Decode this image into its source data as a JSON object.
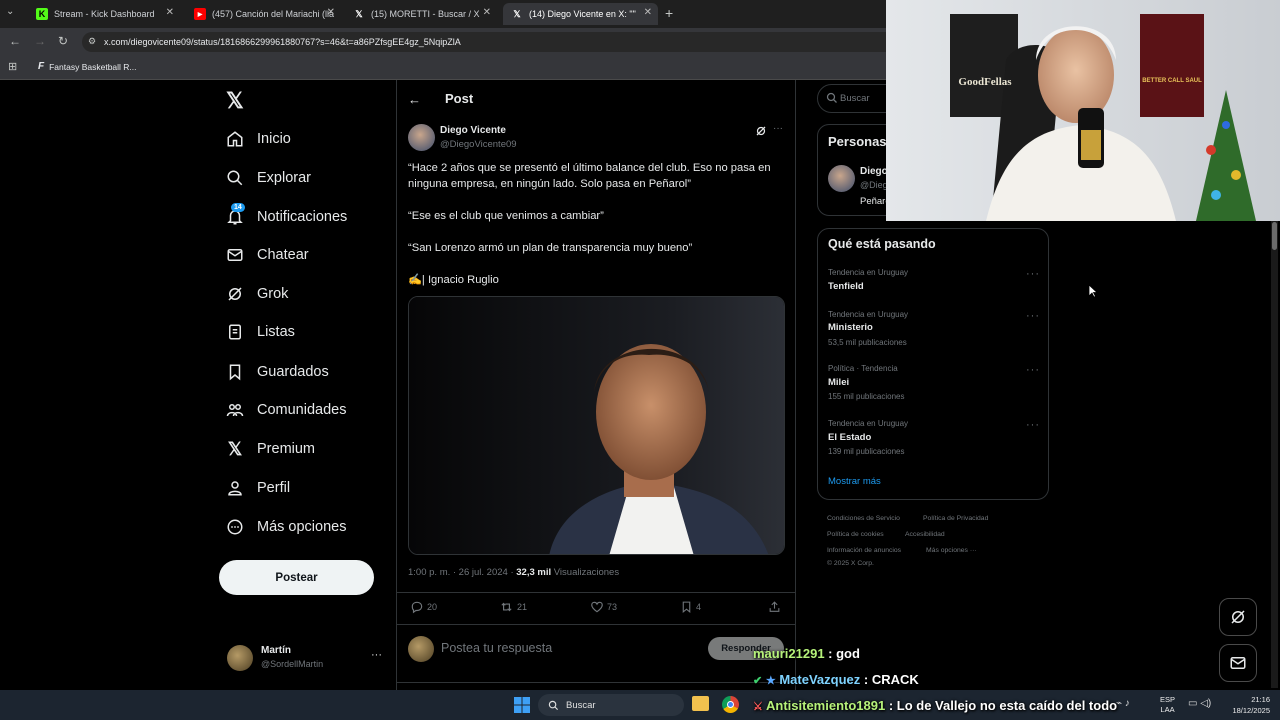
{
  "browser": {
    "tabs": [
      {
        "title": "Stream - Kick Dashboard"
      },
      {
        "title": "(457) Canción del Mariachi (lla"
      },
      {
        "title": "(15) MORETTI - Buscar / X"
      },
      {
        "title": "(14) Diego Vicente en X: \"\""
      }
    ],
    "url": "x.com/diegovicente09/status/1816866299961880767?s=46&t=a86PZfsgEE4gz_5NqipZlA",
    "bookmark": "Fantasy Basketball R..."
  },
  "nav": {
    "items": [
      {
        "label": "Inicio"
      },
      {
        "label": "Explorar"
      },
      {
        "label": "Notificaciones",
        "badge": "14"
      },
      {
        "label": "Chatear"
      },
      {
        "label": "Grok"
      },
      {
        "label": "Listas"
      },
      {
        "label": "Guardados"
      },
      {
        "label": "Comunidades"
      },
      {
        "label": "Premium"
      },
      {
        "label": "Perfil"
      },
      {
        "label": "Más opciones"
      }
    ],
    "post_button": "Postear",
    "account": {
      "name": "Martín",
      "handle": "@SordellMartin"
    }
  },
  "post": {
    "header_title": "Post",
    "author_name": "Diego Vicente",
    "author_handle": "@DiegoVicente09",
    "paragraphs": [
      "“Hace 2 años que se presentó el último balance del club. Eso no pasa en ninguna empresa, en ningún lado. Solo pasa en Peñarol”",
      "“Ese es el club que venimos a cambiar”",
      "“San Lorenzo armó un plan de transparencia muy bueno”",
      "✍️| Ignacio Ruglio"
    ],
    "timestamp": "1:00 p. m. · 26 jul. 2024 · ",
    "views_count": "32,3 mil",
    "views_label": " Visualizaciones",
    "stats": {
      "replies": "20",
      "reposts": "21",
      "likes": "73",
      "bookmarks": "4"
    },
    "reply_placeholder": "Postea tu respuesta",
    "reply_button": "Responder"
  },
  "sidebar": {
    "search_placeholder": "Buscar",
    "people_title": "Personas relevantes",
    "person": {
      "name": "Diego Vicente",
      "handle": "@DiegoVicente09",
      "bio": "Peñarol"
    },
    "trending_title": "Qué está pasando",
    "trends": [
      {
        "meta": "Tendencia en Uruguay",
        "name": "Tenfield",
        "posts": ""
      },
      {
        "meta": "Tendencia en Uruguay",
        "name": "Ministerio",
        "posts": "53,5 mil publicaciones"
      },
      {
        "meta": "Política · Tendencia",
        "name": "Milei",
        "posts": "155 mil publicaciones"
      },
      {
        "meta": "Tendencia en Uruguay",
        "name": "El Estado",
        "posts": "139 mil publicaciones"
      }
    ],
    "show_more": "Mostrar más",
    "footer": [
      "Condiciones de Servicio",
      "Política de Privacidad",
      "Política de cookies",
      "Accesibilidad",
      "Información de anuncios",
      "Más opciones ···",
      "© 2025 X Corp."
    ]
  },
  "webcam": {
    "poster_left": "GoodFellas",
    "poster_right": "BETTER CALL SAUL"
  },
  "chat": [
    {
      "user": "mauri21291",
      "msg": " : god"
    },
    {
      "user": "MateVazquez",
      "msg": " : CRACK"
    },
    {
      "user": "Antisitemiento1891",
      "msg": " : Lo de Vallejo no esta caído del todo"
    }
  ],
  "taskbar": {
    "search": "Buscar",
    "lang": "ESP",
    "lang2": "LAA",
    "time": "21:16",
    "date": "18/12/2025"
  },
  "colors": {
    "accent": "#1d9bf0",
    "chat_user_1": "#b6f27a",
    "chat_user_2": "#7fd3ff",
    "chat_user_3": "#b6f27a"
  }
}
